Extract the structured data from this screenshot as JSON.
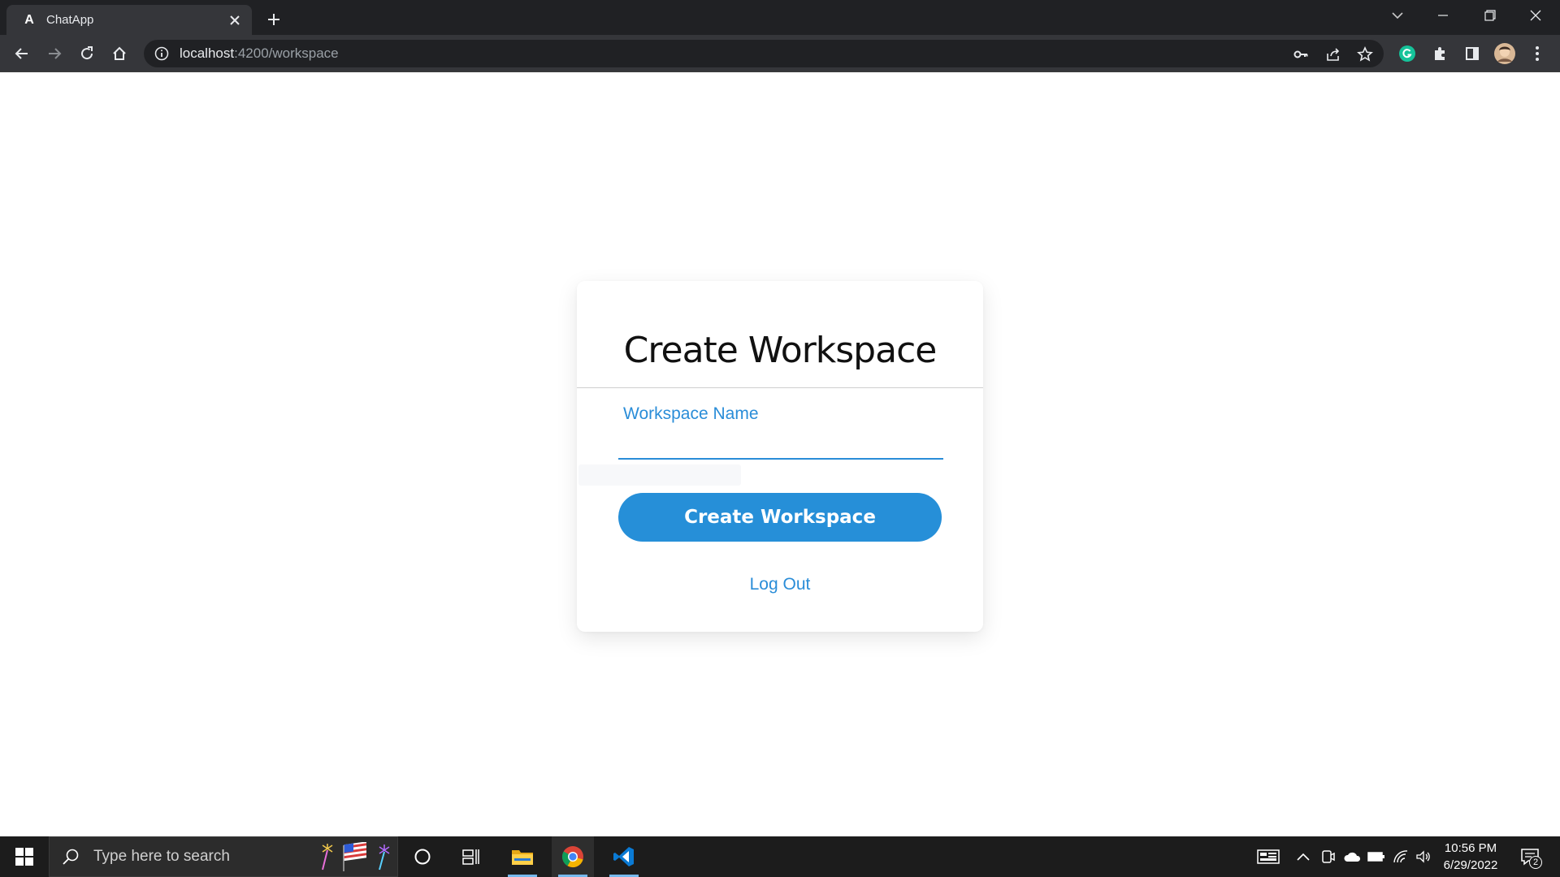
{
  "browser": {
    "tab": {
      "title": "ChatApp",
      "favicon_letter": "A"
    },
    "address": {
      "host": "localhost",
      "path": ":4200/workspace"
    }
  },
  "page": {
    "title": "Create Workspace",
    "workspace_field": {
      "label": "Workspace Name",
      "value": ""
    },
    "create_button": "Create Workspace",
    "logout_link": "Log Out",
    "accent_color": "#268fd8"
  },
  "taskbar": {
    "search_placeholder": "Type here to search",
    "clock": {
      "time": "10:56 PM",
      "date": "6/29/2022"
    },
    "notification_count": "2",
    "pinned": [
      "cortana-icon",
      "task-view-icon",
      "file-explorer-icon",
      "chrome-icon",
      "vscode-icon"
    ]
  }
}
